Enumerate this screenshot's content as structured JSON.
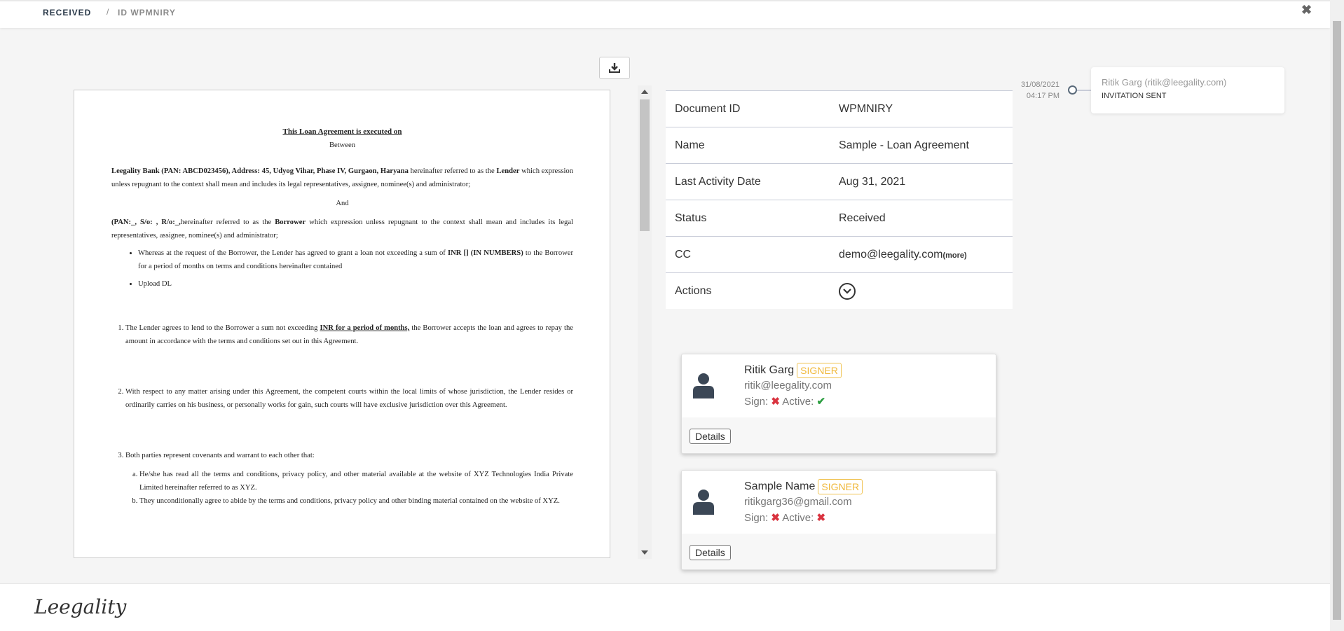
{
  "header": {
    "breadcrumb_section": "RECEIVED",
    "breadcrumb_sep": "/",
    "breadcrumb_id": "ID WPMNIRY",
    "close": "✖"
  },
  "document": {
    "title": "This Loan Agreement is executed on",
    "between": "Between",
    "party1_bold": "Leegality Bank (PAN: ABCD023456), Address: 45, Udyog Vihar, Phase IV, Gurgaon, Haryana ",
    "party1_rest": "hereinafter referred to as the ",
    "party1_lender": "Lender",
    "party1_tail": " which expression unless repugnant to the context shall mean and includes its legal representatives, assignee, nominee(s) and administrator;",
    "and": "And",
    "party2_bold": " (PAN:_, S/o:  , R/o:_,",
    "party2_rest": "hereinafter referred to as the ",
    "party2_borrower": "Borrower",
    "party2_tail": " which expression unless repugnant to the context shall mean and includes its legal representatives, assignee, nominee(s) and administrator;",
    "bullet1_a": "Whereas at the request of the Borrower, the Lender has agreed to grant a loan not exceeding a sum of ",
    "bullet1_b": "INR [] (IN NUMBERS)",
    "bullet1_c": " to the Borrower for a period of  months on terms and conditions hereinafter contained",
    "bullet2": "Upload DL",
    "clause1_a": "The Lender agrees to lend to the Borrower a sum not exceeding ",
    "clause1_b": "INR  for a period of months,",
    "clause1_c": " the Borrower accepts the loan and agrees to repay the amount in accordance with the terms and conditions set out in this Agreement.",
    "clause2": "With respect to any matter arising under this Agreement, the competent courts within the local limits of whose jurisdiction, the Lender resides or ordinarily carries on his business, or personally works for gain, such courts will have exclusive jurisdiction over this Agreement.",
    "clause3": "Both parties represent covenants and warrant to each other that:",
    "clause3a": "He/she has read all the terms and conditions, privacy policy, and other material available at the website of XYZ Technologies India Private Limited hereinafter referred to as XYZ.",
    "clause3b": "They unconditionally agree to abide by the terms and conditions, privacy policy and other binding material contained on the website of XYZ."
  },
  "details": {
    "rows": [
      {
        "key": "Document ID",
        "value": "WPMNIRY"
      },
      {
        "key": "Name",
        "value": "Sample - Loan Agreement"
      },
      {
        "key": "Last Activity Date",
        "value": "Aug 31, 2021"
      },
      {
        "key": "Status",
        "value": "Received"
      },
      {
        "key": "CC",
        "value": "demo@leegality.com",
        "more": "(more)"
      },
      {
        "key": "Actions",
        "value": ""
      }
    ]
  },
  "timeline": {
    "date": "31/08/2021",
    "time": "04:17 PM",
    "name": "Ritik Garg (ritik@leegality.com)",
    "status": "INVITATION SENT"
  },
  "signers": [
    {
      "name": "Ritik Garg",
      "role": "SIGNER",
      "email": "ritik@leegality.com",
      "sign_label": "Sign:",
      "sign_icon": "✖",
      "active_label": "Active:",
      "active_icon": "✔",
      "details": "Details"
    },
    {
      "name": "Sample Name",
      "role": "SIGNER",
      "email": "ritikgarg36@gmail.com",
      "sign_label": "Sign:",
      "sign_icon": "✖",
      "active_label": "Active:",
      "active_icon": "✖",
      "details": "Details"
    }
  ],
  "footer": {
    "logo": "Leegality"
  },
  "colors": {
    "accent": "#2b3a4a",
    "badge": "#f0b83a",
    "error": "#d9333f",
    "success": "#2a9d3f"
  }
}
